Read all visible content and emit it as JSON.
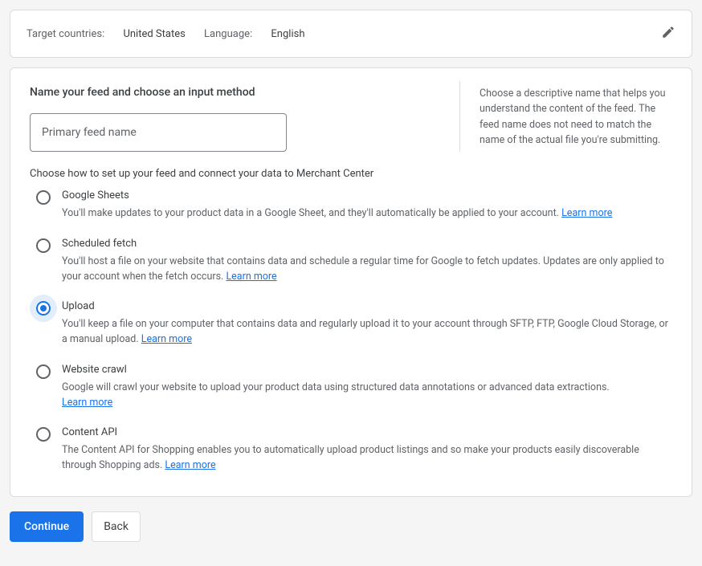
{
  "summary": {
    "countries_label": "Target countries:",
    "countries_value": "United States",
    "language_label": "Language:",
    "language_value": "English"
  },
  "form": {
    "heading": "Name your feed and choose an input method",
    "feed_name_placeholder": "Primary feed name",
    "help_text": "Choose a descriptive name that helps you understand the content of the feed. The feed name does not need to match the name of the actual file you're submitting.",
    "method_label": "Choose how to set up your feed and connect your data to Merchant Center",
    "learn_more": "Learn more",
    "options": [
      {
        "title": "Google Sheets",
        "desc": "You'll make updates to your product data in a Google Sheet, and they'll automatically be applied to your account."
      },
      {
        "title": "Scheduled fetch",
        "desc": "You'll host a file on your website that contains data and schedule a regular time for Google to fetch updates. Updates are only applied to your account when the fetch occurs."
      },
      {
        "title": "Upload",
        "desc": "You'll keep a file on your computer that contains data and regularly upload it to your account through SFTP, FTP, Google Cloud Storage, or a manual upload."
      },
      {
        "title": "Website crawl",
        "desc": "Google will crawl your website to upload your product data using structured data annotations or advanced data extractions."
      },
      {
        "title": "Content API",
        "desc": "The Content API for Shopping enables you to automatically upload product listings and so make your products easily discoverable through Shopping ads."
      }
    ]
  },
  "buttons": {
    "continue": "Continue",
    "back": "Back"
  }
}
